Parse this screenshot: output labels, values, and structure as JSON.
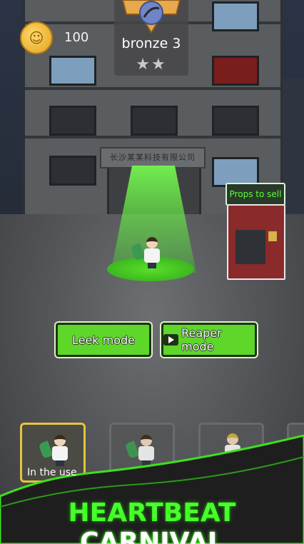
{
  "hud": {
    "coins": "100",
    "rank_name": "bronze 3",
    "stars": "★★"
  },
  "building": {
    "sign_text": "长沙某某科技有限公司"
  },
  "shop": {
    "props_label": "Props to sell"
  },
  "modes": {
    "leek_label": "Leek mode",
    "reaper_label": "Reaper mode"
  },
  "characters": {
    "selected_caption": "In the use"
  },
  "banner": {
    "word1": "HEARTBEAT",
    "word2": "CARNIVAL"
  },
  "colors": {
    "accent_green": "#5fd62a",
    "selected_border": "#e6c53a",
    "vending_red": "#8a2a2a"
  }
}
